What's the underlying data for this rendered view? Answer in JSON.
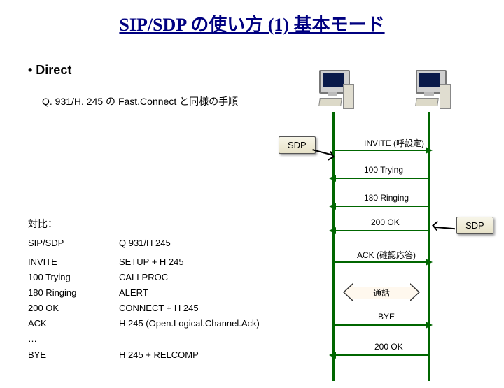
{
  "title": "SIP/SDP の使い方 (1) 基本モード",
  "bullet": "• Direct",
  "subtext": "Q. 931/H. 245 の Fast.Connect と同様の手順",
  "compare_title": "対比：",
  "table": {
    "headers": {
      "sip": "SIP/SDP",
      "h245": "Q 931/H 245"
    },
    "rows": [
      {
        "sip": "INVITE",
        "h245": "SETUP + H 245"
      },
      {
        "sip": "100 Trying",
        "h245": "CALLPROC"
      },
      {
        "sip": "180 Ringing",
        "h245": "ALERT"
      },
      {
        "sip": "200 OK",
        "h245": "CONNECT + H 245"
      },
      {
        "sip": "ACK",
        "h245": "H 245 (Open.Logical.Channel.Ack)"
      },
      {
        "sip": "…",
        "h245": ""
      },
      {
        "sip": "BYE",
        "h245": "H 245 + RELCOMP"
      }
    ]
  },
  "sdp_tag": "SDP",
  "sequence": {
    "messages": [
      {
        "label": "INVITE (呼設定)",
        "dir": "r",
        "sdp_from_left": true
      },
      {
        "label": "100 Trying",
        "dir": "l"
      },
      {
        "label": "180 Ringing",
        "dir": "l"
      },
      {
        "label": "200 OK",
        "dir": "l",
        "sdp_to_right": true
      },
      {
        "label": "ACK (確認応答)",
        "dir": "r"
      }
    ],
    "media": "通話",
    "teardown": [
      {
        "label": "BYE",
        "dir": "r"
      },
      {
        "label": "200 OK",
        "dir": "l"
      }
    ]
  }
}
